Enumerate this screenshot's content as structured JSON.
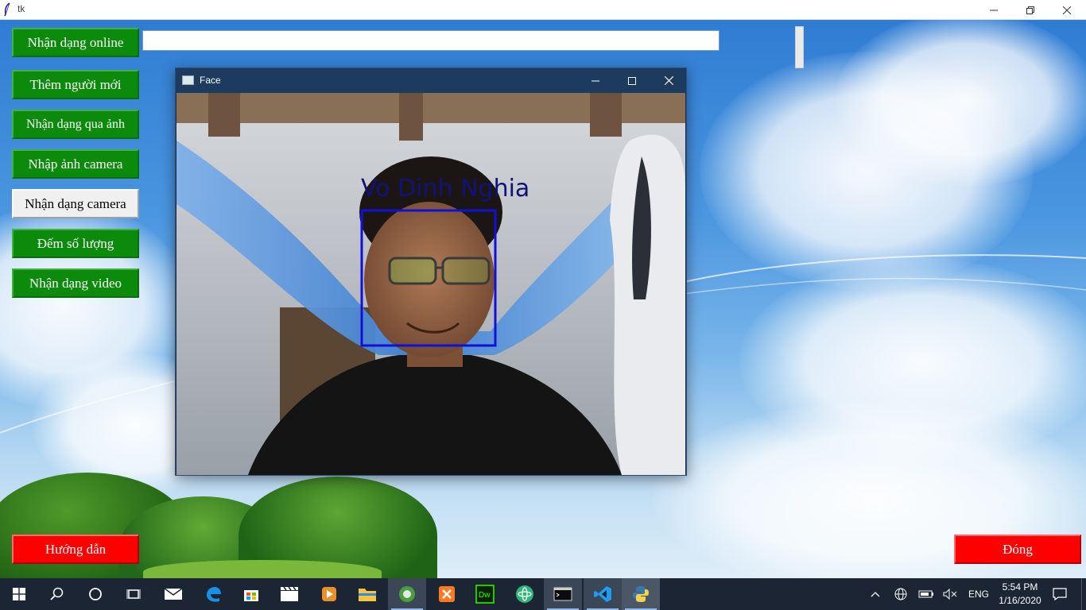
{
  "window": {
    "title": "tk"
  },
  "buttons": {
    "online": "Nhận dạng online",
    "add_person": "Thêm người mới",
    "recognize_photo": "Nhận dạng qua ảnh",
    "import_camera": "Nhập ảnh camera",
    "recognize_camera": "Nhận dạng camera",
    "count": "Đếm số lượng",
    "recognize_video": "Nhận dạng video",
    "guide": "Hướng dẫn",
    "close": "Đóng"
  },
  "entry": {
    "value": ""
  },
  "face_window": {
    "title": "Face",
    "detected_name": "Vo Dinh Nghia"
  },
  "taskbar": {
    "language": "ENG",
    "time": "5:54 PM",
    "date": "1/16/2020"
  },
  "colors": {
    "button_green": "#0b8a0b",
    "button_red": "#ff0000",
    "detection_box": "#1010d8",
    "taskbar": "#1b2533"
  },
  "icons": [
    "feather-icon",
    "minimize-icon",
    "restore-icon",
    "close-icon",
    "windows-start-icon",
    "search-icon",
    "cortana-icon",
    "task-view-icon",
    "mail-icon",
    "edge-icon",
    "store-icon",
    "video-editor-icon",
    "media-player-icon",
    "file-explorer-icon",
    "app-icon",
    "xampp-icon",
    "dreamweaver-icon",
    "atom-icon",
    "terminal-icon",
    "vscode-icon",
    "python-icon",
    "chevron-up-icon",
    "network-icon",
    "battery-icon",
    "volume-muted-icon",
    "notification-icon"
  ]
}
